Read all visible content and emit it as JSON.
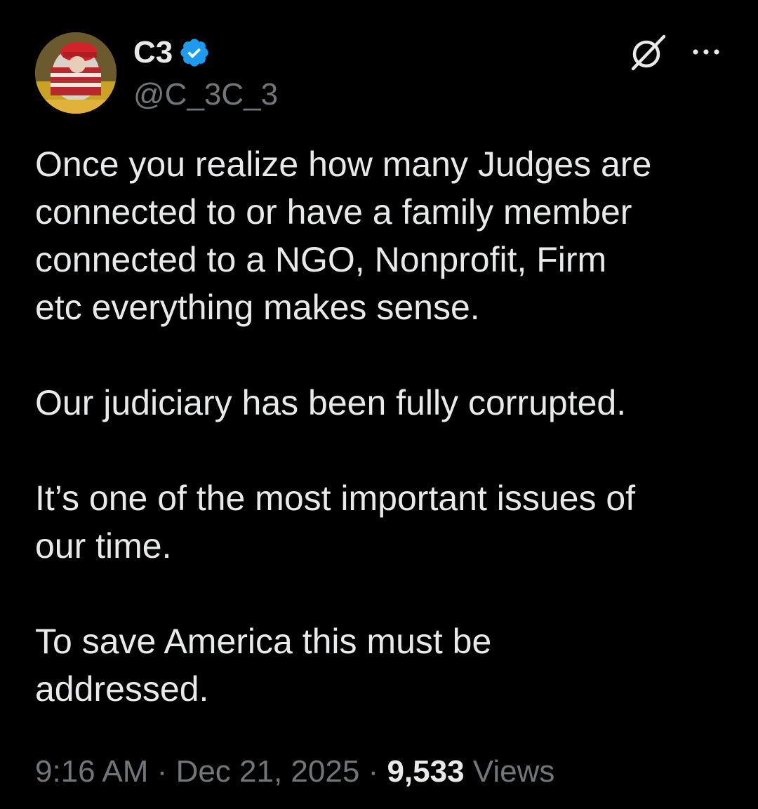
{
  "author": {
    "display_name": "C3",
    "handle": "@C_3C_3",
    "verified": true,
    "verified_color": "#1d9bf0"
  },
  "header_icons": {
    "grok": "grok-icon",
    "more": "more-icon"
  },
  "tweet": {
    "paragraphs": [
      "Once you realize how many Judges are\nconnected to or have a family member\nconnected to a NGO, Nonprofit, Firm\netc everything makes sense.",
      "Our judiciary has been fully corrupted.",
      "It’s one of the most important issues of\nour time.",
      "To save America this must be\naddressed."
    ]
  },
  "meta": {
    "time": "9:16 AM",
    "separator": "·",
    "date": "Dec 21, 2025",
    "views_count": "9,533",
    "views_label": "Views"
  },
  "colors": {
    "background": "#000000",
    "text": "#e7e9ea",
    "secondary": "#71767b",
    "accent": "#1d9bf0"
  }
}
